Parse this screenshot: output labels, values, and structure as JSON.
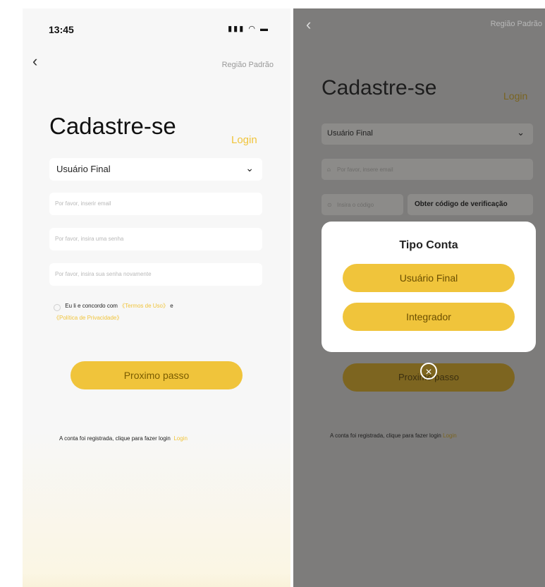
{
  "left": {
    "status": {
      "time": "13:45",
      "icons": "▮▮▮ ◠ ▭"
    },
    "region": "Região Padrão",
    "title": "Cadastre-se",
    "login": "Login",
    "account_type": "Usuário Final",
    "email_placeholder": "Por favor, inserir email",
    "password_placeholder": "Por favor, insira uma senha",
    "password_confirm_placeholder": "Por favor, insira sua senha novamente",
    "terms": {
      "prefix": "Eu li e concordo com",
      "terms_link": "《Termos de Uso》",
      "and": "e",
      "privacy_link": "《Política de Privacidade》"
    },
    "next_button": "Proximo passo",
    "footer_text": "A conta foi registrada, clique para fazer login",
    "footer_link": "Login"
  },
  "right": {
    "region": "Região Padrão",
    "title": "Cadastre-se",
    "login": "Login",
    "account_type": "Usuário Final",
    "email_placeholder": "Por favor, insere email",
    "code_placeholder": "Insira o código",
    "code_button": "Obter código de verificação",
    "next_button": "Proximo passo",
    "footer_text": "A conta foi registrada, clique para fazer login",
    "footer_link": "Login",
    "modal": {
      "title": "Tipo Conta",
      "options": [
        "Usuário Final",
        "Integrador"
      ]
    }
  },
  "colors": {
    "accent": "#f0c43b",
    "overlay": "#7d7c7b"
  },
  "icons": [
    "back-chevron-icon",
    "signal-icon",
    "wifi-icon",
    "battery-icon",
    "chevron-down-icon",
    "user-icon",
    "shield-icon",
    "close-icon"
  ]
}
